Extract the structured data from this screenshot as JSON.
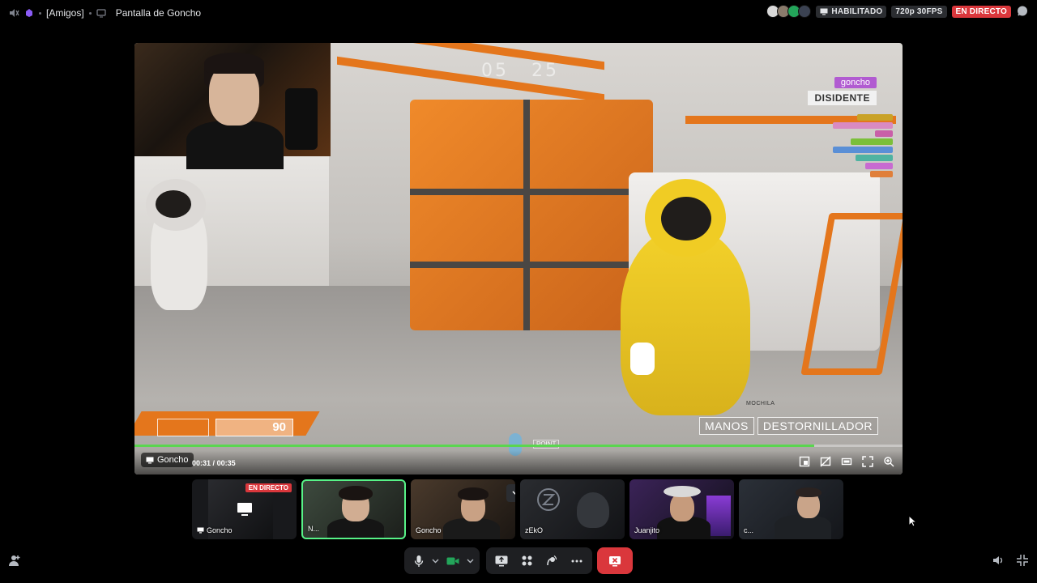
{
  "topbar": {
    "channel_name": "[Amigos]",
    "title": "Pantalla de Goncho",
    "habilitado_label": "HABILITADO",
    "quality": "720p 30FPS",
    "live_label": "EN DIRECTO"
  },
  "stream": {
    "game_timer_minutes": "05",
    "game_timer_seconds": "25",
    "player_name": "goncho",
    "player_role": "DISIDENTE",
    "health": "90",
    "tool_1": "MANOS",
    "tool_2": "DESTORNILLADOR",
    "backpack_label": "MOCHILA",
    "point_label": "POINT",
    "progress_fraction": 0.885,
    "name_tag": "Goncho",
    "time_current": "00:31",
    "time_total": "00:35",
    "time_separator": "/"
  },
  "tiles": [
    {
      "label": "Goncho",
      "badge": "EN DIRECTO"
    },
    {
      "label": "N..."
    },
    {
      "label": "Goncho"
    },
    {
      "label": "zEkO"
    },
    {
      "label": "Juanjito"
    },
    {
      "label": "c..."
    }
  ],
  "colors": {
    "accent_green": "#57f287",
    "live_red": "#da373c",
    "end_call_red": "#da373c",
    "progress_green": "#5ad64f",
    "role_purple": "#b15bd1"
  }
}
